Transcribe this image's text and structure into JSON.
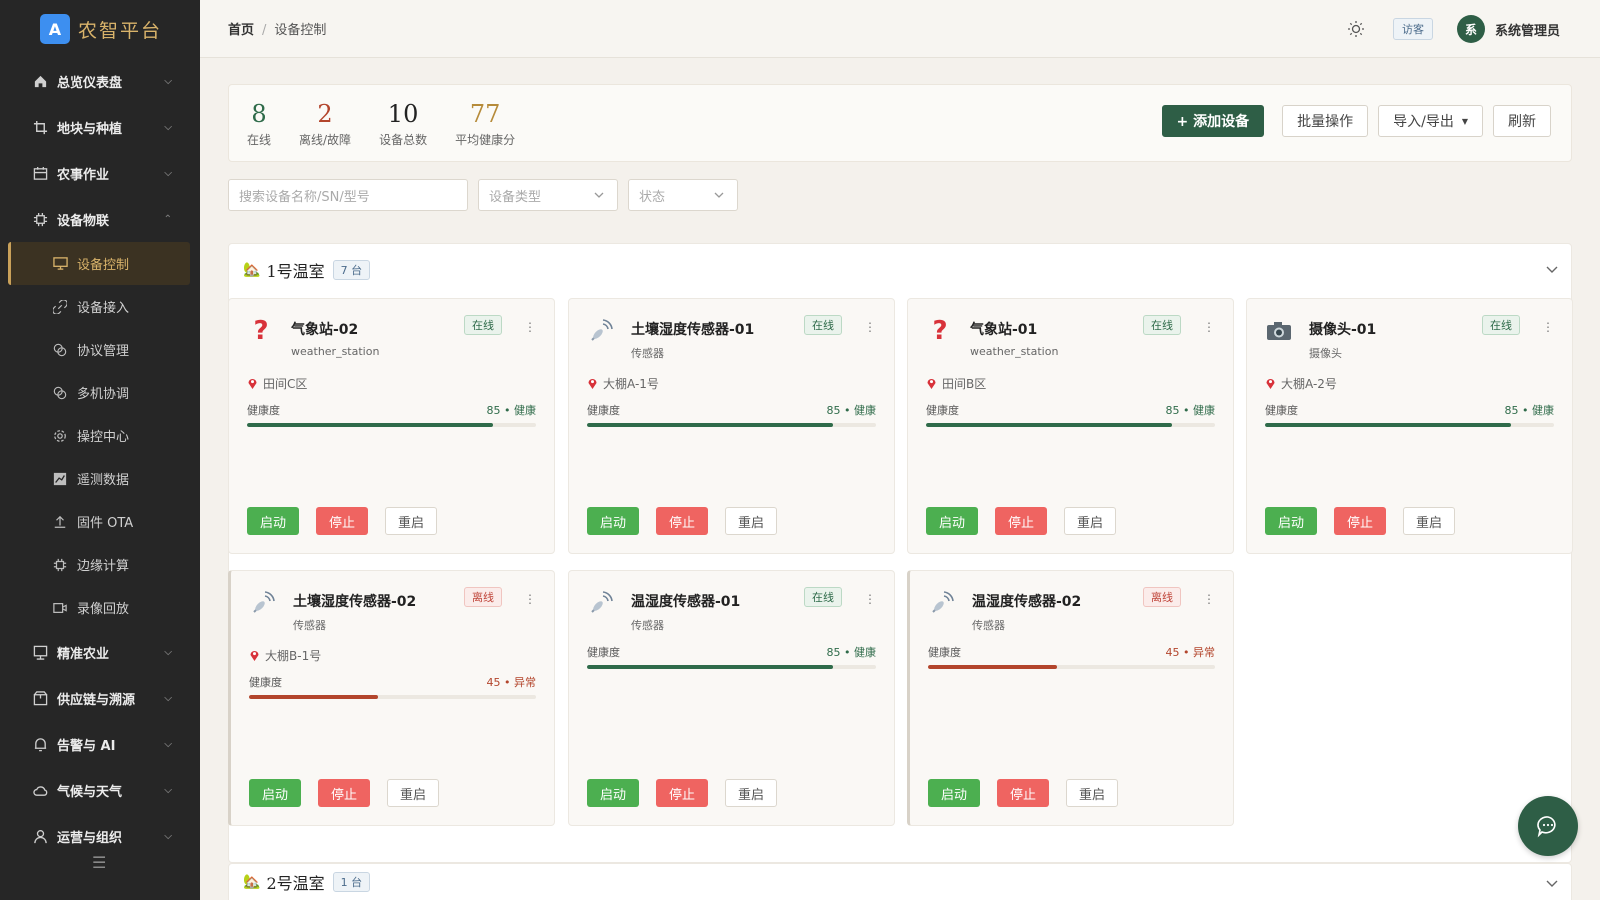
{
  "brand": {
    "logo": "A",
    "name": "农智平台"
  },
  "nav": {
    "items": [
      {
        "label": "总览仪表盘",
        "icon": "home-icon"
      },
      {
        "label": "地块与种植",
        "icon": "crop-icon"
      },
      {
        "label": "农事作业",
        "icon": "calendar-icon"
      }
    ],
    "device_group": {
      "label": "设备物联",
      "icon": "chip-icon"
    },
    "sub_items": [
      {
        "label": "设备控制",
        "icon": "monitor-icon",
        "active": true
      },
      {
        "label": "设备接入",
        "icon": "link-icon"
      },
      {
        "label": "协议管理",
        "icon": "protocol-icon"
      },
      {
        "label": "多机协调",
        "icon": "protocol-icon"
      },
      {
        "label": "操控中心",
        "icon": "gear-icon"
      },
      {
        "label": "遥测数据",
        "icon": "chart-icon"
      },
      {
        "label": "固件 OTA",
        "icon": "upload-icon"
      },
      {
        "label": "边缘计算",
        "icon": "chip-icon"
      },
      {
        "label": "录像回放",
        "icon": "video-icon"
      }
    ],
    "bottom_items": [
      {
        "label": "精准农业",
        "icon": "target-icon"
      },
      {
        "label": "供应链与溯源",
        "icon": "package-icon"
      },
      {
        "label": "告警与 AI",
        "icon": "bell-icon"
      },
      {
        "label": "气候与天气",
        "icon": "cloud-icon"
      },
      {
        "label": "运营与组织",
        "icon": "user-icon"
      }
    ]
  },
  "header": {
    "breadcrumb_home": "首页",
    "breadcrumb_sep": "/",
    "breadcrumb_current": "设备控制",
    "guest_badge": "访客",
    "avatar_initial": "系",
    "user_name": "系统管理员"
  },
  "stats": [
    {
      "value": "8",
      "label": "在线",
      "tone": "green"
    },
    {
      "value": "2",
      "label": "离线/故障",
      "tone": "red"
    },
    {
      "value": "10",
      "label": "设备总数",
      "tone": "dark"
    },
    {
      "value": "77",
      "label": "平均健康分",
      "tone": "gold"
    }
  ],
  "actions": {
    "add": "+ 添加设备",
    "batch": "批量操作",
    "import_export": "导入/导出",
    "refresh": "刷新"
  },
  "filters": {
    "search_placeholder": "搜索设备名称/SN/型号",
    "type_placeholder": "设备类型",
    "status_placeholder": "状态"
  },
  "groups": [
    {
      "title": "1号温室",
      "count": "7 台"
    },
    {
      "title": "2号温室",
      "count": "1 台"
    }
  ],
  "card_labels": {
    "health": "健康度",
    "start": "启动",
    "stop": "停止",
    "restart": "重启"
  },
  "devices": [
    {
      "name": "气象站-02",
      "type": "weather_station",
      "status": "在线",
      "online": true,
      "location": "田间C区",
      "health": 85,
      "health_text": "85 • 健康",
      "icon": "question-icon"
    },
    {
      "name": "土壤湿度传感器-01",
      "type": "传感器",
      "status": "在线",
      "online": true,
      "location": "大棚A-1号",
      "health": 85,
      "health_text": "85 • 健康",
      "icon": "satellite-icon"
    },
    {
      "name": "气象站-01",
      "type": "weather_station",
      "status": "在线",
      "online": true,
      "location": "田间B区",
      "health": 85,
      "health_text": "85 • 健康",
      "icon": "question-icon"
    },
    {
      "name": "摄像头-01",
      "type": "摄像头",
      "status": "在线",
      "online": true,
      "location": "大棚A-2号",
      "health": 85,
      "health_text": "85 • 健康",
      "icon": "camera-icon"
    },
    {
      "name": "土壤湿度传感器-02",
      "type": "传感器",
      "status": "离线",
      "online": false,
      "location": "大棚B-1号",
      "health": 45,
      "health_text": "45 • 异常",
      "icon": "satellite-icon"
    },
    {
      "name": "温湿度传感器-01",
      "type": "传感器",
      "status": "在线",
      "online": true,
      "location": "",
      "health": 85,
      "health_text": "85 • 健康",
      "icon": "satellite-icon"
    },
    {
      "name": "温湿度传感器-02",
      "type": "传感器",
      "status": "离线",
      "online": false,
      "location": "",
      "health": 45,
      "health_text": "45 • 异常",
      "icon": "satellite-icon"
    }
  ],
  "colors": {
    "primary": "#2e5e46",
    "accent": "#d9b36a",
    "danger": "#b3452c",
    "start": "#4caf50",
    "stop": "#ef6461"
  }
}
